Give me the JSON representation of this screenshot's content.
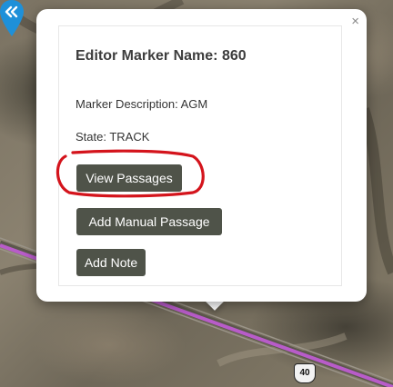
{
  "popup": {
    "close_label": "×",
    "title": "Editor Marker Name: 860",
    "description": "Marker Description: AGM",
    "state": "State: TRACK",
    "buttons": {
      "view_passages": "View Passages",
      "add_manual_passage": "Add Manual Passage",
      "add_note": "Add Note"
    }
  },
  "map": {
    "route_color": "#b85cc9",
    "marker_color": "#1e90d9",
    "marker_icon": "double-chevron-left-icon",
    "highway_shield": "40"
  },
  "annotation": {
    "color": "#d4141c",
    "target": "View Passages"
  }
}
